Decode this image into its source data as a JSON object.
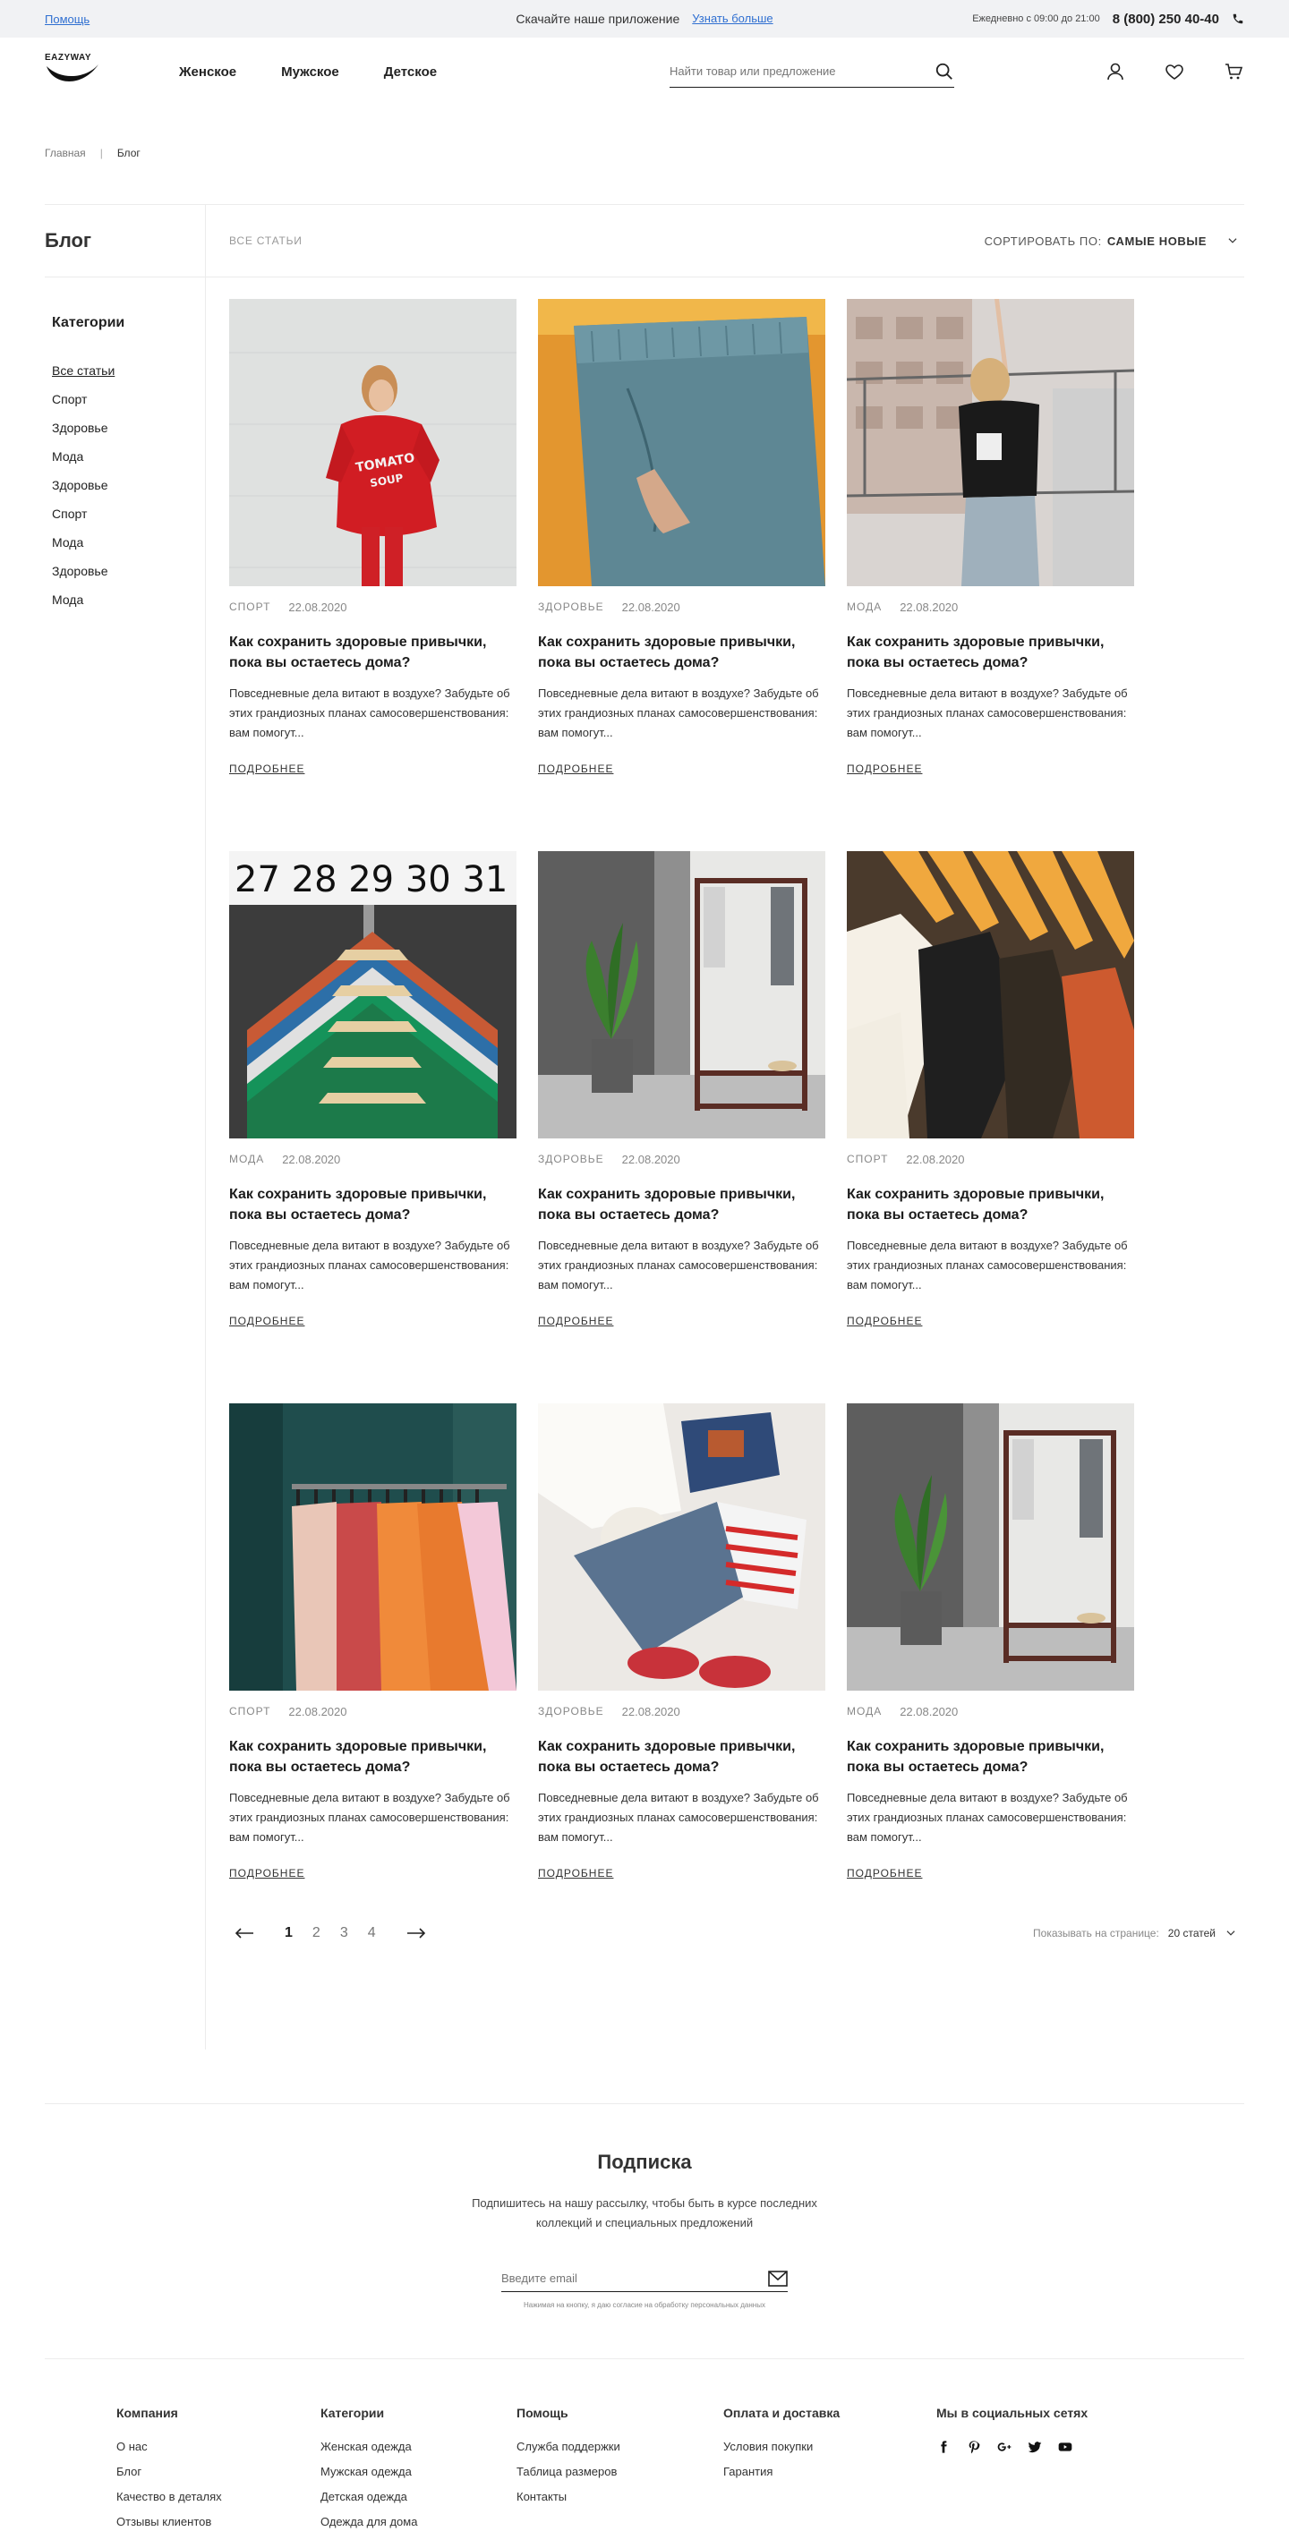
{
  "topbar": {
    "help": "Помощь",
    "promo": "Скачайте наше приложение",
    "promo_link": "Узнать больше",
    "hours": "Ежедневно с 09:00 до 21:00",
    "phone": "8 (800) 250 40-40"
  },
  "header": {
    "logo": "EAZYWAY",
    "nav": [
      "Женское",
      "Мужское",
      "Детское"
    ],
    "search_placeholder": "Найти товар или предложение"
  },
  "breadcrumb": [
    "Главная",
    "Блог"
  ],
  "blog": {
    "title": "Блог",
    "all_articles": "Все статьи",
    "sort_label": "Сортировать по:",
    "sort_value": "Самые новые"
  },
  "sidebar": {
    "title": "Категории",
    "items": [
      "Все статьи",
      "Спорт",
      "Здоровье",
      "Мода",
      "Здоровье",
      "Спорт",
      "Мода",
      "Здоровье",
      "Мода"
    ]
  },
  "articles": [
    {
      "tag": "Спорт",
      "date": "22.08.2020",
      "title": "Как сохранить здоровые привычки, пока вы остаетесь дома?",
      "excerpt": "Повседневные дела витают в воздухе? Забудьте об этих грандиозных планах самосовершенствования: вам помогут...",
      "more": "Подробнее",
      "image": "red-sweater-woman"
    },
    {
      "tag": "Здоровье",
      "date": "22.08.2020",
      "title": "Как сохранить здоровые привычки, пока вы остаетесь дома?",
      "excerpt": "Повседневные дела витают в воздухе? Забудьте об этих грандиозных планах самосовершенствования: вам помогут...",
      "more": "Подробнее",
      "image": "blue-pants-pocket"
    },
    {
      "tag": "Мода",
      "date": "22.08.2020",
      "title": "Как сохранить здоровые привычки, пока вы остаетесь дома?",
      "excerpt": "Повседневные дела витают в воздухе? Забудьте об этих грандиозных планах самосовершенствования: вам помогут...",
      "more": "Подробнее",
      "image": "woman-rooftop"
    },
    {
      "tag": "Мода",
      "date": "22.08.2020",
      "title": "Как сохранить здоровые привычки, пока вы остаетесь дома?",
      "excerpt": "Повседневные дела витают в воздухе? Забудьте об этих грандиозных планах самосовершенствования: вам помогут...",
      "more": "Подробнее",
      "image": "hangers-sizes"
    },
    {
      "tag": "Здоровье",
      "date": "22.08.2020",
      "title": "Как сохранить здоровые привычки, пока вы остаетесь дома?",
      "excerpt": "Повседневные дела витают в воздухе? Забудьте об этих грандиозных планах самосовершенствования: вам помогут...",
      "more": "Подробнее",
      "image": "clothes-rack-plant"
    },
    {
      "tag": "Спорт",
      "date": "22.08.2020",
      "title": "Как сохранить здоровые привычки, пока вы остаетесь дома?",
      "excerpt": "Повседневные дела витают в воздухе? Забудьте об этих грандиозных планах самосовершенствования: вам помогут...",
      "more": "Подробнее",
      "image": "wooden-hangers"
    },
    {
      "tag": "Спорт",
      "date": "22.08.2020",
      "title": "Как сохранить здоровые привычки, пока вы остаетесь дома?",
      "excerpt": "Повседневные дела витают в воздухе? Забудьте об этих грандиозных планах самосовершенствования: вам помогут...",
      "more": "Подробнее",
      "image": "store-rack"
    },
    {
      "tag": "Здоровье",
      "date": "22.08.2020",
      "title": "Как сохранить здоровые привычки, пока вы остаетесь дома?",
      "excerpt": "Повседневные дела витают в воздухе? Забудьте об этих грандиозных планах самосовершенствования: вам помогут...",
      "more": "Подробнее",
      "image": "flatlay-outfit"
    },
    {
      "tag": "Мода",
      "date": "22.08.2020",
      "title": "Как сохранить здоровые привычки, пока вы остаетесь дома?",
      "excerpt": "Повседневные дела витают в воздухе? Забудьте об этих грандиозных планах самосовершенствования: вам помогут...",
      "more": "Подробнее",
      "image": "clothes-rack-plant"
    }
  ],
  "pagination": {
    "pages": [
      "1",
      "2",
      "3",
      "4"
    ],
    "active": "1",
    "per_page_label": "Показывать на странице:",
    "per_page_value": "20 статей"
  },
  "subscribe": {
    "title": "Подписка",
    "text": "Подпишитесь на нашу рассылку, чтобы быть в курсе последних коллекций и специальных предложений",
    "placeholder": "Введите email",
    "note": "Нажимая на кнопку, я даю согласие на обработку персональных данных"
  },
  "footer": {
    "columns": [
      {
        "title": "Компания",
        "items": [
          "О нас",
          "Блог",
          "Качество в деталях",
          "Отзывы клиентов"
        ]
      },
      {
        "title": "Категории",
        "items": [
          "Женская одежда",
          "Мужская одежда",
          "Детская одежда",
          "Одежда для дома"
        ]
      },
      {
        "title": "Помощь",
        "items": [
          "Служба поддержки",
          "Таблица размеров",
          "Контакты"
        ]
      },
      {
        "title": "Оплата и доставка",
        "items": [
          "Условия покупки",
          "Гарантия"
        ]
      }
    ],
    "social_title": "Мы в социальных сетях",
    "socials": [
      "facebook-icon",
      "pinterest-icon",
      "google-plus-icon",
      "twitter-icon",
      "youtube-icon"
    ]
  }
}
